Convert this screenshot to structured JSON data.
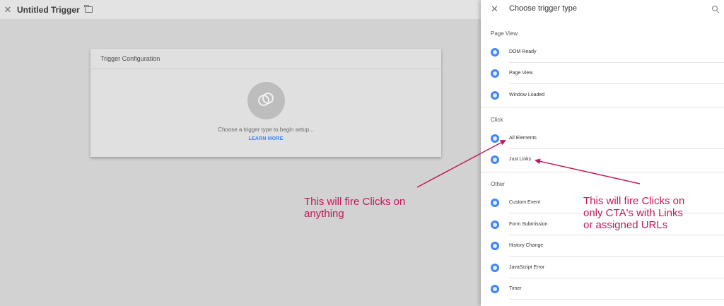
{
  "topbar": {
    "title": "Untitled Trigger",
    "close_glyph": "✕"
  },
  "card": {
    "header": "Trigger Configuration",
    "hint": "Choose a trigger type to begin setup...",
    "learn_more": "LEARN MORE"
  },
  "panel": {
    "close_glyph": "✕",
    "title": "Choose trigger type",
    "sections": [
      {
        "label": "Page View",
        "items": [
          {
            "label": "DOM Ready",
            "icon": "eye-icon"
          },
          {
            "label": "Page View",
            "icon": "eye-icon"
          },
          {
            "label": "Window Loaded",
            "icon": "eye-icon"
          }
        ]
      },
      {
        "label": "Click",
        "items": [
          {
            "label": "All Elements",
            "icon": "click-icon"
          },
          {
            "label": "Just Links",
            "icon": "link-click-icon"
          }
        ]
      },
      {
        "label": "Other",
        "items": [
          {
            "label": "Custom Event",
            "icon": "code-icon"
          },
          {
            "label": "Form Submission",
            "icon": "form-icon"
          },
          {
            "label": "History Change",
            "icon": "history-icon"
          },
          {
            "label": "JavaScript Error",
            "icon": "warning-icon"
          },
          {
            "label": "Timer",
            "icon": "timer-icon"
          }
        ]
      }
    ]
  },
  "annotations": {
    "left_line1": "This will fire Clicks on",
    "left_line2": "anything",
    "right_line1": "This will fire Clicks on",
    "right_line2": "only CTA's with Links",
    "right_line3": "or assigned URLs"
  },
  "colors": {
    "accent": "#4285f4",
    "annotation": "#c2185b"
  }
}
